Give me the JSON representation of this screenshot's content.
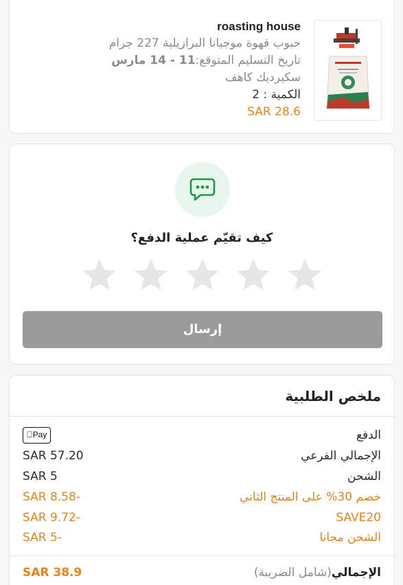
{
  "product": {
    "brand": "roasting house",
    "name": "حبوب قهوة موجيانا البرازيلية 227 جرام",
    "delivery_label": "تاريخ التسليم المتوقع:",
    "delivery_value": "11 - 14 مارس",
    "variant": "سكيرديك كاهف",
    "quantity": "الكمية : 2",
    "price": "SAR 28.6",
    "image_icon": "coffee-bag-image"
  },
  "rating": {
    "icon": "chat-bubble-icon",
    "question": "كيف تقيّم عملية الدفع؟",
    "stars": 5,
    "selected": 0,
    "submit_label": "إرسال"
  },
  "summary": {
    "title": "ملخص الطلبية",
    "rows": [
      {
        "label": "الدفع",
        "value": "Pay",
        "kind": "applepay"
      },
      {
        "label": "الإجمالي الفرعي",
        "value": "SAR 57.20"
      },
      {
        "label": "الشحن",
        "value": "SAR 5"
      },
      {
        "label": "خصم 30% على المنتج الثاني",
        "value": "SAR 8.58-",
        "accent": true
      },
      {
        "label": "SAVE20",
        "value": "SAR 9.72-",
        "accent": true
      },
      {
        "label": "الشحن مجانا",
        "value": "SAR 5-",
        "accent": true
      }
    ],
    "total_label": "الإجمالي",
    "total_sub": "(شامل الضريبة)",
    "total_value": "SAR 38.9"
  },
  "colors": {
    "accent": "#e8821a",
    "chat_green": "#1a9a4a",
    "chat_bg": "#e8f5ec",
    "button_disabled": "#9b9b9b",
    "star_empty": "#e6e6e6"
  }
}
